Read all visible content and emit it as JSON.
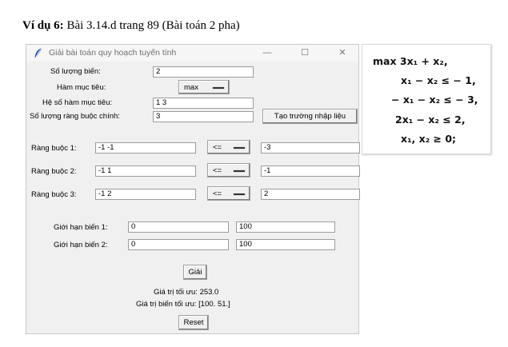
{
  "doc": {
    "heading_bold": "Ví dụ 6:",
    "heading_rest": " Bài 3.14.d trang 89 (Bài toán 2 pha)"
  },
  "window": {
    "title": "Giải bài toán quy hoạch tuyến tính",
    "minimize_glyph": "—",
    "maximize_glyph": "☐",
    "close_glyph": "✕",
    "app_icon": "feather-icon"
  },
  "form": {
    "num_vars_label": "Số lượng biến:",
    "num_vars_value": "2",
    "objective_label": "Hàm mục tiêu:",
    "objective_value": "max",
    "coef_label": "Hệ số hàm mục tiêu:",
    "coef_value": "1 3",
    "num_constraints_label": "Số lượng ràng buộc chính:",
    "num_constraints_value": "3",
    "create_fields_button": "Tạo trường nhập liệu",
    "constraints": [
      {
        "label": "Ràng buộc 1:",
        "coefs": "-1 -1",
        "sign": "<=",
        "rhs": "-3"
      },
      {
        "label": "Ràng buộc 2:",
        "coefs": "-1 1",
        "sign": "<=",
        "rhs": "-1"
      },
      {
        "label": "Ràng buộc 3:",
        "coefs": "-1 2",
        "sign": "<=",
        "rhs": "2"
      }
    ],
    "bounds": [
      {
        "label": "Giới hạn biến 1:",
        "lower": "0",
        "upper": "100"
      },
      {
        "label": "Giới hạn biến 2:",
        "lower": "0",
        "upper": "100"
      }
    ],
    "solve_button": "Giải",
    "optimal_value_text": "Giá trị tối ưu: 253.0",
    "optimal_vars_text": "Giá trị biến tối ưu: [100.  51.]",
    "reset_button": "Reset"
  },
  "problem": {
    "lines": [
      "max  3x₁ + x₂,",
      "x₁ − x₂ ≤ − 1,",
      "− x₁ − x₂ ≤ − 3,",
      "2x₁ − x₂ ≤  2,",
      "x₁, x₂ ≥  0;"
    ]
  }
}
